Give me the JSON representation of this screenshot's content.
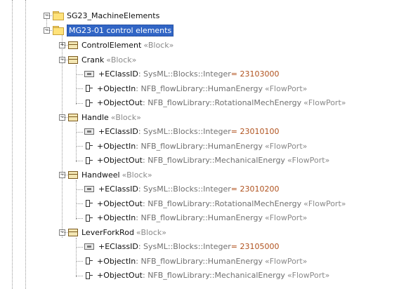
{
  "tree": {
    "root": {
      "label": "SG23_MachineElements",
      "expanded": true
    },
    "package": {
      "label": "MG23-01 control elements",
      "expanded": true,
      "selected": true
    },
    "control_element": {
      "name": "ControlElement",
      "stereotype": "«Block»",
      "expanded": false
    },
    "blocks": [
      {
        "name": "Crank",
        "stereotype": "«Block»",
        "members": [
          {
            "kind": "attribute",
            "name": "+EClassID",
            "type": " : SysML::Blocks::Integer",
            "value": " = 23103000"
          },
          {
            "kind": "port",
            "name": "+ObjectIn",
            "type": " : NFB_flowLibrary::HumanEnergy",
            "stereotype": "«FlowPort»"
          },
          {
            "kind": "port",
            "name": "+ObjectOut",
            "type": " : NFB_flowLibrary::RotationalMechEnergy",
            "stereotype": "«FlowPort»"
          }
        ]
      },
      {
        "name": "Handle",
        "stereotype": "«Block»",
        "members": [
          {
            "kind": "attribute",
            "name": "+EClassID",
            "type": " : SysML::Blocks::Integer",
            "value": " = 23010100"
          },
          {
            "kind": "port",
            "name": "+ObjectIn",
            "type": " : NFB_flowLibrary::HumanEnergy",
            "stereotype": "«FlowPort»"
          },
          {
            "kind": "port",
            "name": "+ObjectOut",
            "type": " : NFB_flowLibrary::MechanicalEnergy",
            "stereotype": "«FlowPort»"
          }
        ]
      },
      {
        "name": "Handweel",
        "stereotype": "«Block»",
        "members": [
          {
            "kind": "attribute",
            "name": "+EClassID",
            "type": " : SysML::Blocks::Integer",
            "value": " = 23010200"
          },
          {
            "kind": "port",
            "name": "+ObjectOut",
            "type": " : NFB_flowLibrary::RotationalMechEnergy",
            "stereotype": "«FlowPort»"
          },
          {
            "kind": "port",
            "name": "+ObjectIn",
            "type": " : NFB_flowLibrary::HumanEnergy",
            "stereotype": "«FlowPort»"
          }
        ]
      },
      {
        "name": "LeverForkRod",
        "stereotype": "«Block»",
        "members": [
          {
            "kind": "attribute",
            "name": "+EClassID",
            "type": " : SysML::Blocks::Integer",
            "value": " = 23105000"
          },
          {
            "kind": "port",
            "name": "+ObjectIn",
            "type": " : NFB_flowLibrary::HumanEnergy",
            "stereotype": "«FlowPort»"
          },
          {
            "kind": "port",
            "name": "+ObjectOut",
            "type": " : NFB_flowLibrary::MechanicalEnergy",
            "stereotype": "«FlowPort»"
          }
        ]
      }
    ]
  },
  "icons": {
    "expanded": "minus",
    "collapsed": "plus",
    "folder": "folder-icon",
    "block": "block-icon",
    "attribute": "attribute-icon",
    "port": "flow-port-icon"
  },
  "colors": {
    "selection": "#3165c5",
    "value": "#b0521e",
    "stereotype": "#8a8a8a",
    "type": "#707070"
  }
}
